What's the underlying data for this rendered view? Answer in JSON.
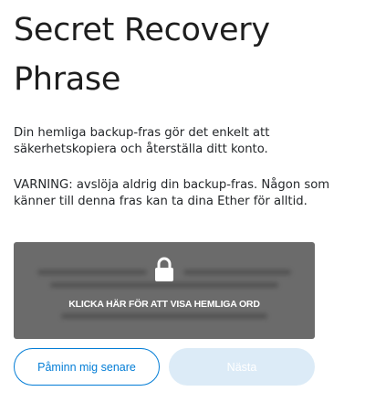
{
  "title": "Secret Recovery Phrase",
  "description": "Din hemliga backup-fras gör det enkelt att säkerhetskopiera och återställa ditt konto.",
  "warning": "VARNING: avslöja aldrig din backup-fras. Någon som känner till denna fras kan ta dina Ether för alltid.",
  "reveal": {
    "label": "KLICKA HÄR FÖR ATT VISA HEMLIGA ORD",
    "icon": "lock-icon"
  },
  "buttons": {
    "remind_later": "Påminn mig senare",
    "next": "Nästa"
  },
  "colors": {
    "accent": "#037dd6",
    "reveal_background": "#6b6b6b",
    "disabled_button": "#dcebf7"
  }
}
